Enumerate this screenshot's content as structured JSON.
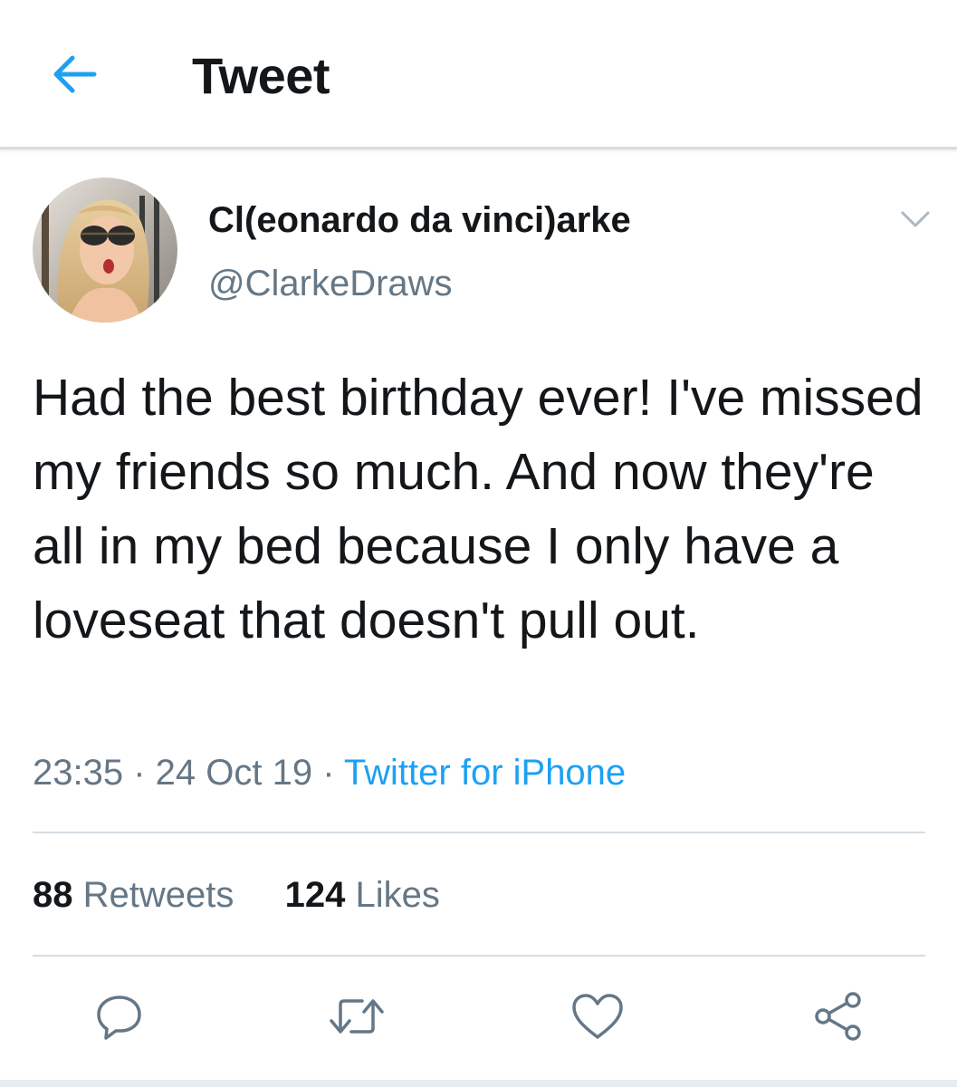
{
  "header": {
    "title": "Tweet",
    "back_icon": "arrow-left-icon",
    "accent_color": "#1da1f2"
  },
  "tweet": {
    "display_name": "Cl(eonardo da vinci)arke",
    "handle": "@ClarkeDraws",
    "text": "Had the best birthday ever! I've missed my friends so much. And now they're all in my bed because I only have a loveseat that doesn't pull out.",
    "time": "23:35",
    "date": "24 Oct 19",
    "separator": " · ",
    "source": "Twitter for iPhone"
  },
  "stats": {
    "retweets_count": "88",
    "retweets_label": "Retweets",
    "likes_count": "124",
    "likes_label": "Likes"
  },
  "actions": {
    "reply_icon": "reply-icon",
    "retweet_icon": "retweet-icon",
    "like_icon": "heart-icon",
    "share_icon": "share-icon"
  },
  "colors": {
    "text": "#14171a",
    "secondary": "#657786",
    "link": "#1da1f2",
    "divider": "#d5dde3"
  }
}
